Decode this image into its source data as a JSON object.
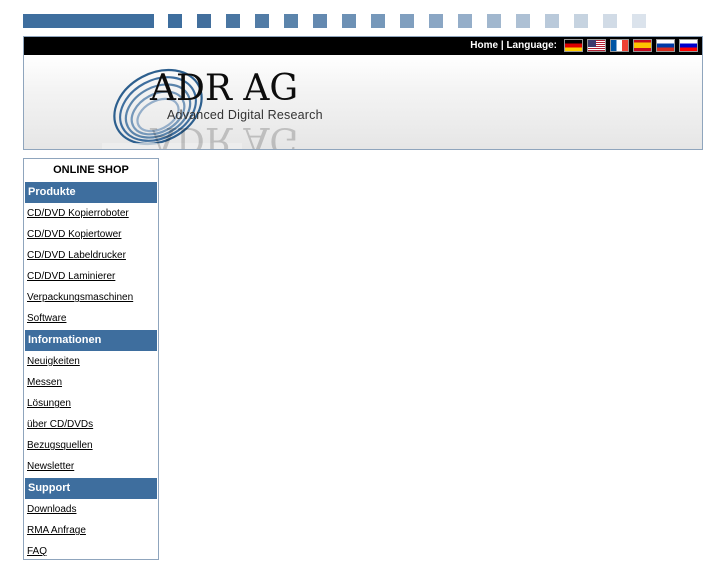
{
  "colors": {
    "accent": "#3e6e9e",
    "header_bar": "#000000",
    "border": "#8fa5bd"
  },
  "topstrip": {
    "square_colors": [
      "#3e6e9e",
      "#436f9d",
      "#4a76a2",
      "#527ca6",
      "#5b84ab",
      "#6489b0",
      "#6d91b5",
      "#7698ba",
      "#809fbf",
      "#8aa6c4",
      "#95aec9",
      "#a1b7ce",
      "#adc0d4",
      "#b9c9da",
      "#c6d3e0",
      "#d1dbe6",
      "#dbe3ec"
    ]
  },
  "header": {
    "home_label": "Home",
    "separator": "|",
    "language_label": "Language:",
    "flags": [
      "de",
      "us",
      "fr",
      "es",
      "ru",
      "si"
    ]
  },
  "logo": {
    "title": "ADR AG",
    "subtitle": "Advanced Digital Research"
  },
  "sidebar": {
    "title": "ONLINE SHOP",
    "sections": [
      {
        "label": "Produkte",
        "links": [
          "CD/DVD Kopierroboter",
          "CD/DVD Kopiertower",
          "CD/DVD Labeldrucker",
          "CD/DVD Laminierer",
          "Verpackungsmaschinen",
          "Software"
        ]
      },
      {
        "label": "Informationen",
        "links": [
          "Neuigkeiten",
          "Messen",
          "Lösungen ",
          "über CD/DVDs",
          "Bezugsquellen",
          "Newsletter"
        ]
      },
      {
        "label": "Support",
        "links": [
          "Downloads",
          "RMA Anfrage",
          "FAQ"
        ]
      }
    ]
  }
}
